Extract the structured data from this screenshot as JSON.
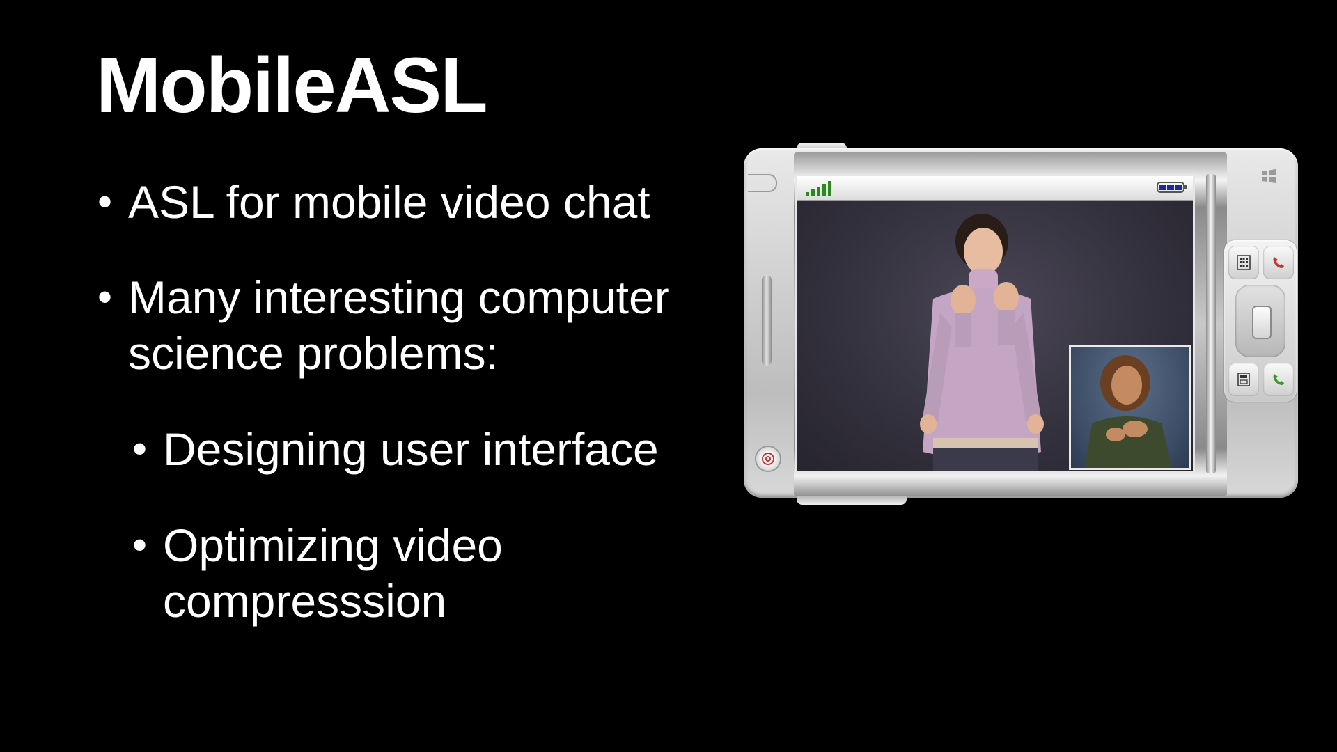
{
  "slide": {
    "title": "MobileASL",
    "bullets": [
      {
        "text": "ASL for mobile video chat",
        "level": 1
      },
      {
        "text": "Many interesting computer\nscience problems:",
        "level": 1
      },
      {
        "text": "Designing user interface",
        "level": 2
      },
      {
        "text": "Optimizing video\ncompresssion",
        "level": 2
      }
    ],
    "bullet_glyph": "•"
  },
  "phone": {
    "icons": [
      "signal-strength-icon",
      "battery-icon",
      "windows-logo-icon",
      "keypad-icon",
      "end-call-icon",
      "call-icon",
      "contacts-icon",
      "power-icon"
    ],
    "colors": {
      "signal": "#2b8a1e",
      "battery": "#1d2a9c",
      "call": "#3a9a2a",
      "end_call": "#c8322c"
    }
  }
}
